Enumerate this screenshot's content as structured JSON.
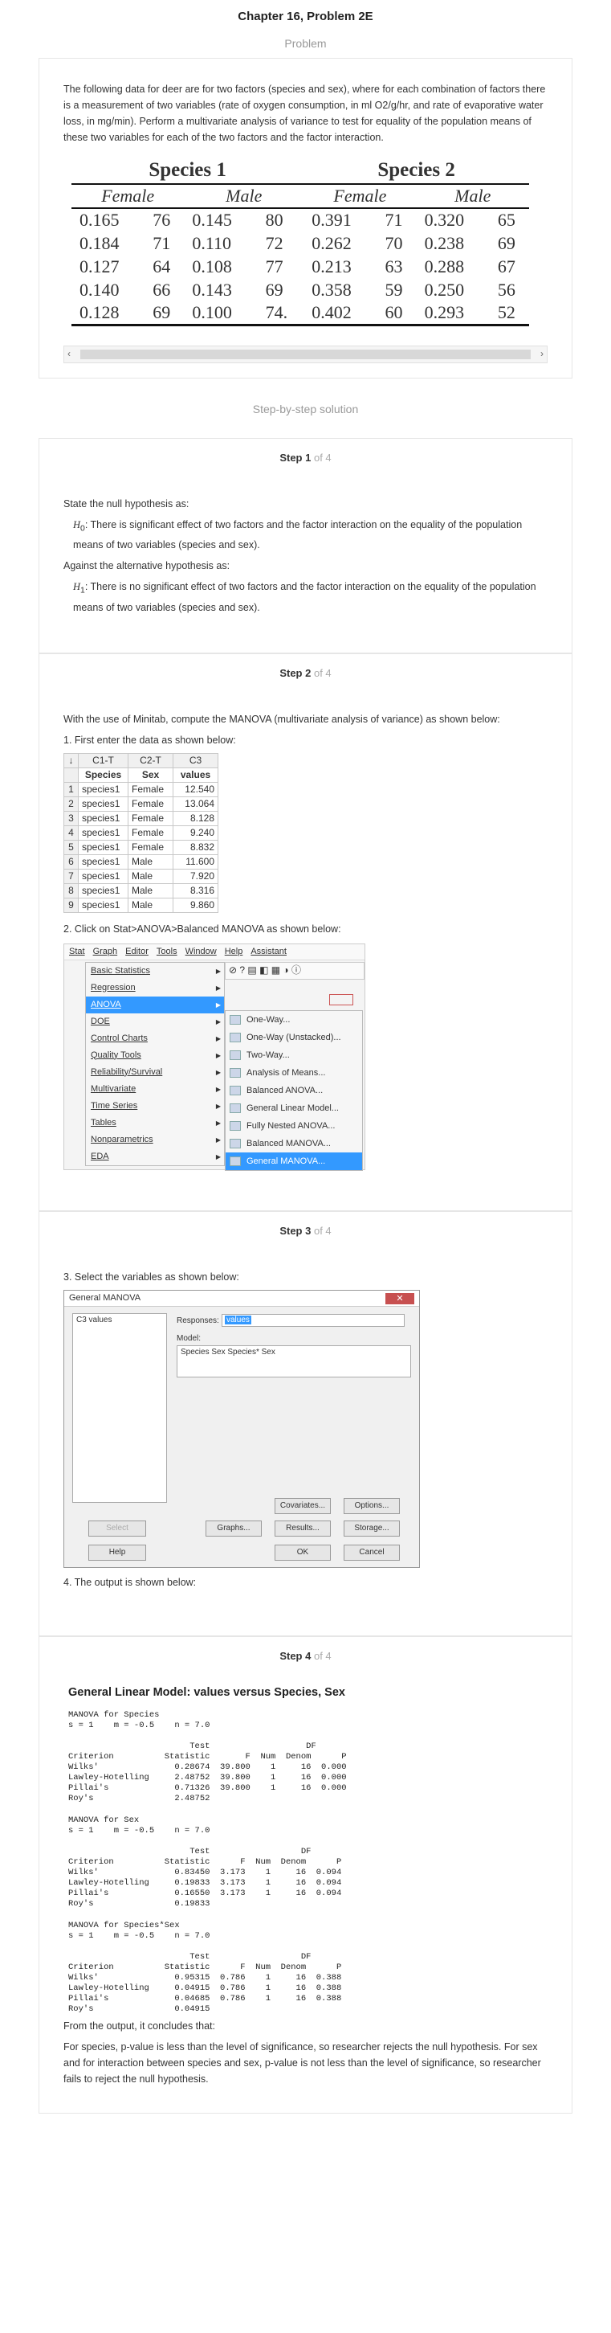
{
  "header": {
    "chapter_title": "Chapter 16, Problem 2E",
    "problem_label": "Problem"
  },
  "problem": {
    "text": "The following data for deer are for two factors (species and sex), where for each combination of factors there is a measurement of two variables (rate of oxygen consumption, in ml O2/g/hr, and rate of evaporative water loss, in mg/min). Perform a multivariate analysis of variance to test for equality of the population means of these two variables for each of the two factors and the factor interaction.",
    "species1": "Species 1",
    "species2": "Species 2",
    "female": "Female",
    "male": "Male",
    "rows": [
      [
        "0.165",
        "76",
        "0.145",
        "80",
        "0.391",
        "71",
        "0.320",
        "65"
      ],
      [
        "0.184",
        "71",
        "0.110",
        "72",
        "0.262",
        "70",
        "0.238",
        "69"
      ],
      [
        "0.127",
        "64",
        "0.108",
        "77",
        "0.213",
        "63",
        "0.288",
        "67"
      ],
      [
        "0.140",
        "66",
        "0.143",
        "69",
        "0.358",
        "59",
        "0.250",
        "56"
      ],
      [
        "0.128",
        "69",
        "0.100",
        "74.",
        "0.402",
        "60",
        "0.293",
        "52"
      ]
    ],
    "scroll_left": "‹",
    "scroll_right": "›"
  },
  "solution_label": "Step-by-step solution",
  "step1": {
    "num": "Step 1",
    "of": "of 4",
    "null_intro": "State the null hypothesis as:",
    "h0_sym": "H",
    "h0_sub": "0",
    "h0_text": ": There is significant effect of two factors and the factor interaction on the equality of the population means of two variables (species and sex).",
    "alt_intro": "Against the alternative hypothesis as:",
    "h1_sym": "H",
    "h1_sub": "1",
    "h1_text": ": There is no significant effect of two factors and the factor interaction on the equality of the population means of two variables (species and sex)."
  },
  "step2": {
    "num": "Step 2",
    "of": "of 4",
    "intro": "With the use of Minitab, compute the MANOVA (multivariate analysis of variance) as shown below:",
    "item1": "1. First enter the data as shown below:",
    "ws_cols": [
      "C1-T",
      "C2-T",
      "C3"
    ],
    "ws_names": [
      "Species",
      "Sex",
      "values"
    ],
    "ws_rows": [
      [
        "1",
        "species1",
        "Female",
        "12.540"
      ],
      [
        "2",
        "species1",
        "Female",
        "13.064"
      ],
      [
        "3",
        "species1",
        "Female",
        "8.128"
      ],
      [
        "4",
        "species1",
        "Female",
        "9.240"
      ],
      [
        "5",
        "species1",
        "Female",
        "8.832"
      ],
      [
        "6",
        "species1",
        "Male",
        "11.600"
      ],
      [
        "7",
        "species1",
        "Male",
        "7.920"
      ],
      [
        "8",
        "species1",
        "Male",
        "8.316"
      ],
      [
        "9",
        "species1",
        "Male",
        "9.860"
      ]
    ],
    "item2": "2. Click on Stat>ANOVA>Balanced MANOVA as shown below:",
    "menubar": [
      "Stat",
      "Graph",
      "Editor",
      "Tools",
      "Window",
      "Help",
      "Assistant"
    ],
    "stat_items": [
      "Basic Statistics",
      "Regression",
      "ANOVA",
      "DOE",
      "Control Charts",
      "Quality Tools",
      "Reliability/Survival",
      "Multivariate",
      "Time Series",
      "Tables",
      "Nonparametrics",
      "EDA"
    ],
    "anova_items": [
      "One-Way...",
      "One-Way (Unstacked)...",
      "Two-Way...",
      "Analysis of Means...",
      "Balanced ANOVA...",
      "General Linear Model...",
      "Fully Nested ANOVA...",
      "Balanced MANOVA...",
      "General MANOVA..."
    ],
    "toolbar_text": "⊘ ? ▤ ◧ ▦ ◑ ⓘ"
  },
  "step3": {
    "num": "Step 3",
    "of": "of 4",
    "item3": "3. Select the variables as shown below:",
    "dlg_title": "General MANOVA",
    "dlg_close": "✕",
    "var_entry": "C3   values",
    "responses_label": "Responses:",
    "responses_value": "values",
    "model_label": "Model:",
    "model_value": "Species Sex Species* Sex",
    "btn_covariates": "Covariates...",
    "btn_options": "Options...",
    "btn_select": "Select",
    "btn_graphs": "Graphs...",
    "btn_results": "Results...",
    "btn_storage": "Storage...",
    "btn_help": "Help",
    "btn_ok": "OK",
    "btn_cancel": "Cancel",
    "item4": "4. The output is shown below:"
  },
  "step4": {
    "num": "Step 4",
    "of": "of 4",
    "out_title": "General Linear Model: values versus Species, Sex",
    "out_species": "MANOVA for Species\ns = 1    m = -0.5    n = 7.0\n\n                        Test                   DF\nCriterion          Statistic       F  Num  Denom      P\nWilks'               0.28674  39.800    1     16  0.000\nLawley-Hotelling     2.48752  39.800    1     16  0.000\nPillai's             0.71326  39.800    1     16  0.000\nRoy's                2.48752",
    "out_sex": "MANOVA for Sex\ns = 1    m = -0.5    n = 7.0\n\n                        Test                  DF\nCriterion          Statistic      F  Num  Denom      P\nWilks'               0.83450  3.173    1     16  0.094\nLawley-Hotelling     0.19833  3.173    1     16  0.094\nPillai's             0.16550  3.173    1     16  0.094\nRoy's                0.19833",
    "out_inter": "MANOVA for Species*Sex\ns = 1    m = -0.5    n = 7.0\n\n                        Test                  DF\nCriterion          Statistic      F  Num  Denom      P\nWilks'               0.95315  0.786    1     16  0.388\nLawley-Hotelling     0.04915  0.786    1     16  0.388\nPillai's             0.04685  0.786    1     16  0.388\nRoy's                0.04915",
    "conclude_intro": "From the output, it concludes that:",
    "conclusion": "For species, p-value is less than the level of significance, so researcher rejects the null hypothesis. For sex and for interaction between species and sex, p-value is not less than the level of significance, so researcher fails to reject the null hypothesis."
  }
}
